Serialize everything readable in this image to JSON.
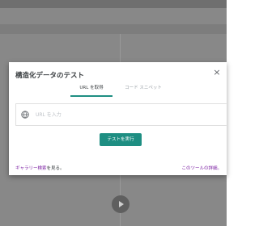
{
  "dialog": {
    "title": "構造化データのテスト",
    "close_label": "×",
    "tabs": [
      {
        "label": "URL を取得",
        "active": true
      },
      {
        "label": "コード スニペット",
        "active": false
      }
    ],
    "url_input": {
      "placeholder": "URL を入力",
      "value": ""
    },
    "run_button_label": "テストを実行",
    "footer": {
      "gallery_link": "ギャラリー検索",
      "gallery_suffix": "を見る。",
      "tool_details_link": "このツールの詳細。"
    }
  },
  "colors": {
    "accent": "#1e8e82",
    "link": "#7b1fa2",
    "overlay": "#888888"
  },
  "icons": {
    "close": "close-icon",
    "globe": "globe-icon",
    "play": "play-icon"
  }
}
